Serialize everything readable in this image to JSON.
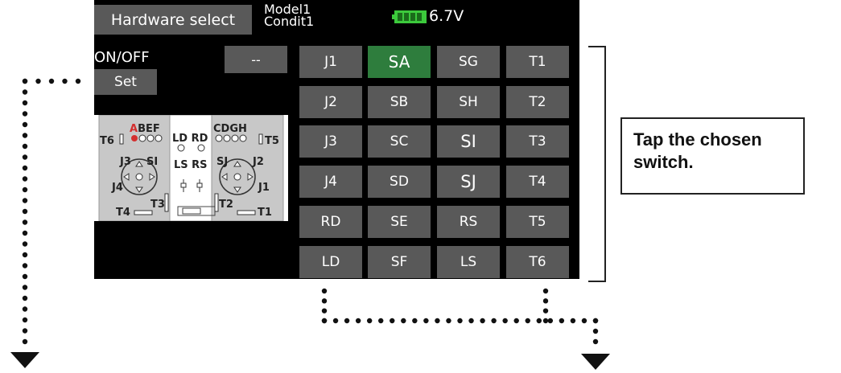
{
  "header": {
    "title_button": "Hardware select",
    "model_line1": "Model1",
    "model_line2": "Condit1",
    "voltage": "6.7V"
  },
  "left_panel": {
    "onoff_label": "ON/OFF",
    "set_button": "Set",
    "current_value": "--"
  },
  "switch_grid": {
    "columns": [
      [
        "J1",
        "J2",
        "J3",
        "J4",
        "RD",
        "LD"
      ],
      [
        "SA",
        "SB",
        "SC",
        "SD",
        "SE",
        "SF"
      ],
      [
        "SG",
        "SH",
        "SI",
        "SJ",
        "RS",
        "LS"
      ],
      [
        "T1",
        "T2",
        "T3",
        "T4",
        "T5",
        "T6"
      ]
    ],
    "selected": "SA"
  },
  "radio_labels": {
    "abef": "ABEF",
    "abef_first": "A",
    "abef_rest": "BEF",
    "cdgh": "CDGH",
    "ldrd": "LD RD",
    "lsrs": "LS RS",
    "t6": "T6",
    "t5": "T5",
    "t4": "T4",
    "t3": "T3",
    "t2": "T2",
    "t1": "T1",
    "j3": "J3",
    "j4": "J4",
    "si": "SI",
    "sj": "SJ",
    "j2": "J2",
    "j1": "J1"
  },
  "callout": {
    "text": "Tap the chosen switch."
  },
  "colors": {
    "screen_bg": "#000000",
    "button_bg": "#595959",
    "selected_bg": "#2e7d3d",
    "battery": "#3cc93c",
    "radio_panel": "#c8c8c8",
    "highlight_red": "#d32f2f"
  }
}
